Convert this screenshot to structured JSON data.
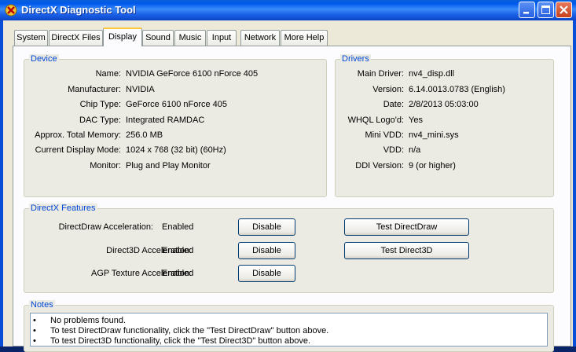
{
  "window": {
    "title": "DirectX Diagnostic Tool",
    "icon": "directx-x-icon",
    "controls": [
      "minimize-icon",
      "maximize-icon",
      "close-icon"
    ],
    "colors": {
      "titlebar": "#0058ee",
      "group_label": "#0046d5",
      "active_tab_highlight": "#ffc83c"
    }
  },
  "tabs": [
    {
      "label": "System"
    },
    {
      "label": "DirectX Files"
    },
    {
      "label": "Display",
      "active": true
    },
    {
      "label": "Sound"
    },
    {
      "label": "Music"
    },
    {
      "label": "Input"
    },
    {
      "label": "Network"
    },
    {
      "label": "More Help"
    }
  ],
  "device": {
    "title": "Device",
    "rows": [
      {
        "label": "Name:",
        "value": "NVIDIA GeForce 6100 nForce 405"
      },
      {
        "label": "Manufacturer:",
        "value": "NVIDIA"
      },
      {
        "label": "Chip Type:",
        "value": "GeForce 6100 nForce 405"
      },
      {
        "label": "DAC Type:",
        "value": "Integrated RAMDAC"
      },
      {
        "label": "Approx. Total Memory:",
        "value": "256.0 MB"
      },
      {
        "label": "Current Display Mode:",
        "value": "1024 x 768 (32 bit) (60Hz)"
      },
      {
        "label": "Monitor:",
        "value": "Plug and Play Monitor"
      }
    ]
  },
  "drivers": {
    "title": "Drivers",
    "rows": [
      {
        "label": "Main Driver:",
        "value": "nv4_disp.dll"
      },
      {
        "label": "Version:",
        "value": "6.14.0013.0783 (English)"
      },
      {
        "label": "Date:",
        "value": "2/8/2013 05:03:00"
      },
      {
        "label": "WHQL Logo'd:",
        "value": "Yes"
      },
      {
        "label": "Mini VDD:",
        "value": "nv4_mini.sys"
      },
      {
        "label": "VDD:",
        "value": "n/a"
      },
      {
        "label": "DDI Version:",
        "value": "9 (or higher)"
      }
    ]
  },
  "features": {
    "title": "DirectX Features",
    "rows": [
      {
        "label": "DirectDraw Acceleration:",
        "value": "Enabled",
        "button": "Disable",
        "test": "Test DirectDraw"
      },
      {
        "label": "Direct3D Acceleration:",
        "value": "Enabled",
        "button": "Disable",
        "test": "Test Direct3D"
      },
      {
        "label": "AGP Texture Acceleration:",
        "value": "Enabled",
        "button": "Disable"
      }
    ]
  },
  "notes": {
    "title": "Notes",
    "bullet": "•",
    "items": [
      "No problems found.",
      "To test DirectDraw functionality, click the \"Test DirectDraw\" button above.",
      "To test Direct3D functionality, click the \"Test Direct3D\" button above."
    ]
  }
}
